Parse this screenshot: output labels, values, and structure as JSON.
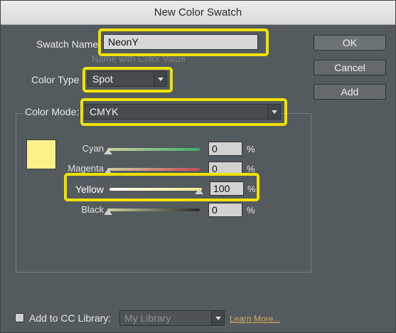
{
  "dialog": {
    "title": "New Color Swatch"
  },
  "swatch_name": {
    "label": "Swatch Name",
    "value": "NeonY",
    "name_with_value_label": "Name with Color Value"
  },
  "color_type": {
    "label": "Color Type",
    "value": "Spot"
  },
  "color_mode": {
    "label": "Color Mode:",
    "value": "CMYK"
  },
  "buttons": {
    "ok": "OK",
    "cancel": "Cancel",
    "add": "Add"
  },
  "sliders": [
    {
      "label": "Cyan",
      "value": "0",
      "unit": "%",
      "fraction": 0,
      "color": "#3fae6a"
    },
    {
      "label": "Magenta",
      "value": "0",
      "unit": "%",
      "fraction": 0,
      "color": "#c84b57"
    },
    {
      "label": "Yellow",
      "value": "100",
      "unit": "%",
      "fraction": 1,
      "color": "#f2ec8a"
    },
    {
      "label": "Black",
      "value": "0",
      "unit": "%",
      "fraction": 0,
      "color": "#2a2a2a"
    }
  ],
  "preview_color": "#fbf08a",
  "highlight_color": "#f0e100",
  "footer": {
    "cc_label": "Add to CC Library:",
    "library_value": "My Library",
    "learn_more": "Learn More..."
  },
  "icons": [
    "dropdown-arrow-icon",
    "slider-thumb-icon",
    "checkbox-icon"
  ]
}
